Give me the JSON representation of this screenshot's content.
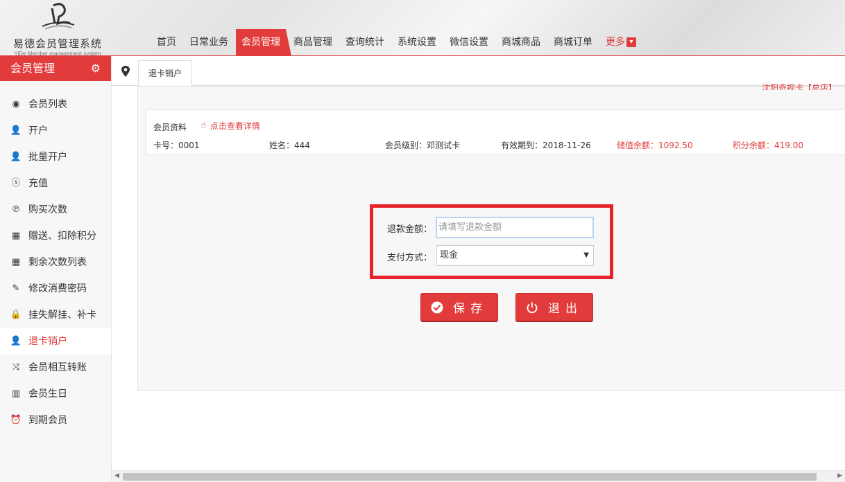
{
  "app": {
    "title": "易德会员管理系统",
    "subtitle": "YiDe Member management system"
  },
  "nav": {
    "items": [
      "首页",
      "日常业务",
      "会员管理",
      "商品管理",
      "查询统计",
      "系统设置",
      "微信设置",
      "商城商品",
      "商城订单"
    ],
    "active_index": 2,
    "more_label": "更多",
    "more_icon": "chevron-down-icon"
  },
  "sidebar": {
    "title": "会员管理",
    "settings_icon": "gear-icon",
    "items": [
      {
        "label": "会员列表",
        "icon": "user-circle-icon"
      },
      {
        "label": "开户",
        "icon": "user-icon"
      },
      {
        "label": "批量开户",
        "icon": "user-icon"
      },
      {
        "label": "充值",
        "icon": "coin-icon"
      },
      {
        "label": "购买次数",
        "icon": "paypal-icon"
      },
      {
        "label": "赠送、扣除积分",
        "icon": "map-icon"
      },
      {
        "label": "剩余次数列表",
        "icon": "map-icon"
      },
      {
        "label": "修改消费密码",
        "icon": "pencil-icon"
      },
      {
        "label": "挂失解挂、补卡",
        "icon": "lock-icon"
      },
      {
        "label": "退卡销户",
        "icon": "user-remove-icon"
      },
      {
        "label": "会员相互转账",
        "icon": "shuffle-icon"
      },
      {
        "label": "会员生日",
        "icon": "cake-icon"
      },
      {
        "label": "到期会员",
        "icon": "alarm-clock-icon"
      }
    ],
    "active_index": 9
  },
  "tabs": {
    "current": "退卡销户"
  },
  "notice": "沈阳奇视卡【总店】",
  "member": {
    "section_title": "会员资料",
    "detail_link": "点击查看详情",
    "card_no": "卡号：0001",
    "name": "姓名：444",
    "level": "会员级别：邓测试卡",
    "expiry": "有效期到：2018-11-26",
    "balance": "储值余额：1092.50",
    "points": "积分余额：419.00"
  },
  "form": {
    "refund_label": "退款金额：",
    "refund_placeholder": "请填写退款金额",
    "refund_value": "",
    "payment_label": "支付方式：",
    "payment_selected": "现金"
  },
  "buttons": {
    "save": "保存",
    "exit": "退出"
  },
  "colors": {
    "accent": "#e23b3b",
    "highlight_box": "#e8232b"
  }
}
